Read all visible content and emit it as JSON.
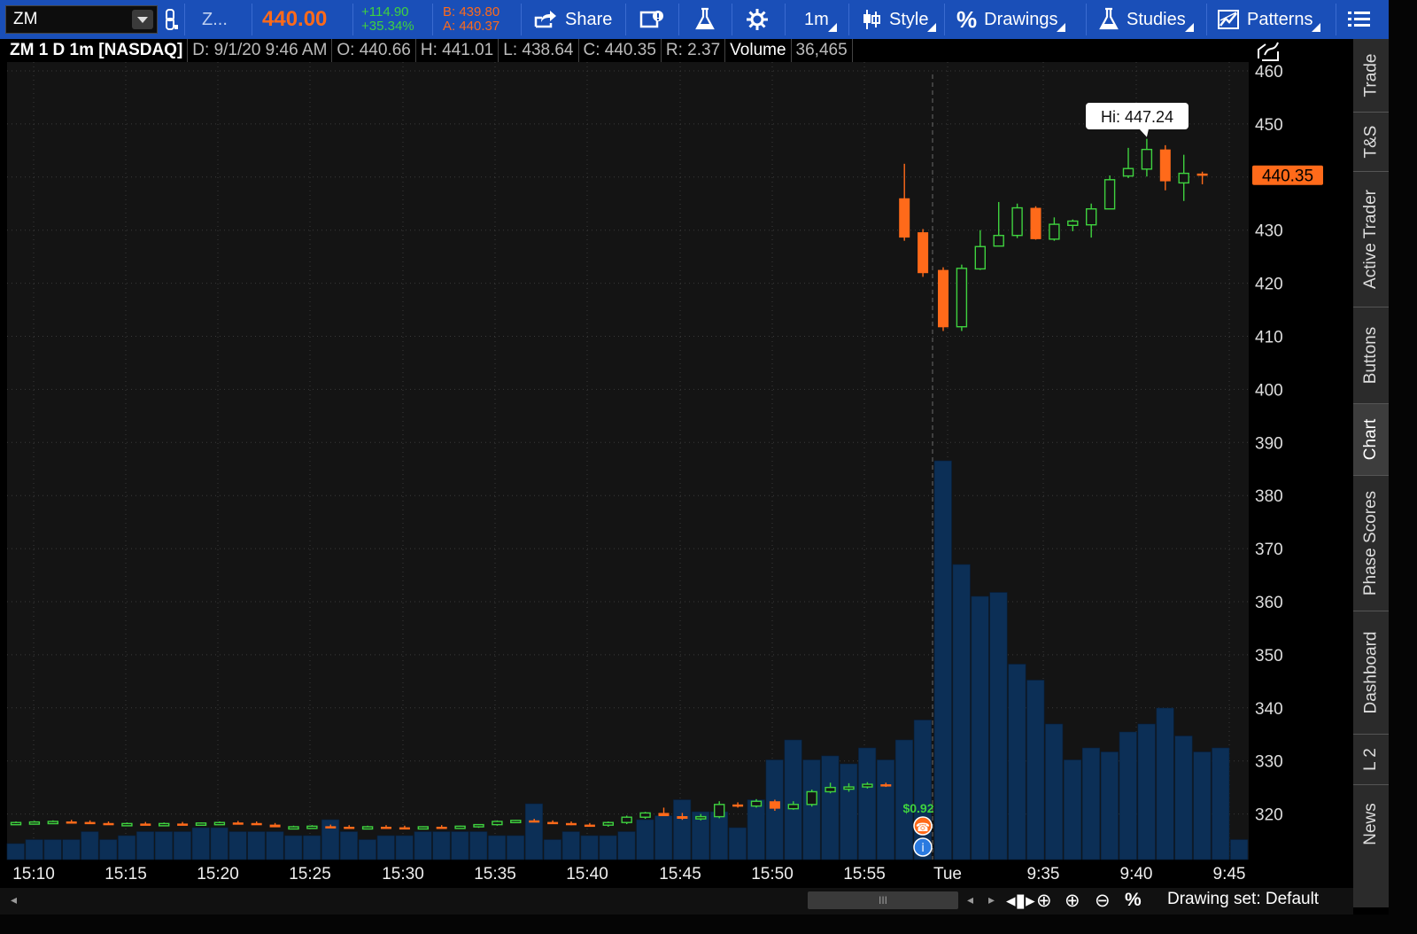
{
  "toolbar": {
    "symbol": "ZM",
    "link_icon": "chain-link-icon",
    "company_short": "Z...",
    "last_price": "440.00",
    "net_change": "+114.90",
    "pct_change": "+35.34%",
    "bid": "B: 439.80",
    "ask": "A: 440.37",
    "share_label": "Share",
    "aggregation": "1m",
    "style_label": "Style",
    "drawings_label": "Drawings",
    "studies_label": "Studies",
    "patterns_label": "Patterns",
    "colors": {
      "accent": "#1a4fb8",
      "price": "#ff6a1a",
      "up": "#3fd23f",
      "down": "#ff6a1a"
    }
  },
  "header": {
    "title": "ZM 1 D 1m [NASDAQ]",
    "date": "D: 9/1/20 9:46 AM",
    "open": "O: 440.66",
    "high": "H: 441.01",
    "low": "L: 438.64",
    "close": "C: 440.35",
    "range": "R: 2.37",
    "volume_label": "Volume",
    "volume_value": "36,465"
  },
  "side_tabs": [
    "Trade",
    "T&S",
    "Active Trader",
    "Buttons",
    "Chart",
    "Phase Scores",
    "Dashboard",
    "L 2",
    "News"
  ],
  "active_tab": "Chart",
  "bottom": {
    "drawing_set": "Drawing set: Default",
    "scroll_grip": "III"
  },
  "chart_data": {
    "type": "candlestick",
    "price_axis": {
      "ticks": [
        460,
        450,
        440,
        430,
        420,
        410,
        400,
        390,
        380,
        370,
        360,
        350,
        340,
        330,
        320
      ],
      "range": [
        311,
        462
      ]
    },
    "time_axis_labels": [
      "15:10",
      "15:15",
      "15:20",
      "15:25",
      "15:30",
      "15:35",
      "15:40",
      "15:45",
      "15:50",
      "15:55",
      "Tue",
      "9:35",
      "9:40",
      "9:45"
    ],
    "last_price_marker": "440.35",
    "hi_label": "Hi: 447.24",
    "event_label": "$0.92",
    "candles": [
      {
        "o": 318.3,
        "h": 318.6,
        "l": 318.0,
        "c": 318.4
      },
      {
        "o": 318.4,
        "h": 318.7,
        "l": 318.1,
        "c": 318.5
      },
      {
        "o": 318.5,
        "h": 318.8,
        "l": 318.2,
        "c": 318.6
      },
      {
        "o": 318.6,
        "h": 318.9,
        "l": 318.3,
        "c": 318.5
      },
      {
        "o": 318.5,
        "h": 318.8,
        "l": 318.2,
        "c": 318.3
      },
      {
        "o": 318.3,
        "h": 318.6,
        "l": 318.0,
        "c": 318.1
      },
      {
        "o": 318.1,
        "h": 318.4,
        "l": 317.8,
        "c": 318.2
      },
      {
        "o": 318.2,
        "h": 318.5,
        "l": 317.9,
        "c": 318.0
      },
      {
        "o": 318.0,
        "h": 318.4,
        "l": 317.8,
        "c": 318.2
      },
      {
        "o": 318.2,
        "h": 318.5,
        "l": 317.9,
        "c": 318.1
      },
      {
        "o": 318.1,
        "h": 318.4,
        "l": 317.8,
        "c": 318.3
      },
      {
        "o": 318.3,
        "h": 318.6,
        "l": 318.0,
        "c": 318.4
      },
      {
        "o": 318.4,
        "h": 318.7,
        "l": 318.1,
        "c": 318.3
      },
      {
        "o": 318.3,
        "h": 318.6,
        "l": 318.0,
        "c": 318.0
      },
      {
        "o": 318.0,
        "h": 318.3,
        "l": 317.6,
        "c": 317.5
      },
      {
        "o": 317.5,
        "h": 317.8,
        "l": 317.2,
        "c": 317.6
      },
      {
        "o": 317.6,
        "h": 317.9,
        "l": 317.3,
        "c": 317.7
      },
      {
        "o": 317.7,
        "h": 318.0,
        "l": 317.4,
        "c": 317.6
      },
      {
        "o": 317.6,
        "h": 317.9,
        "l": 317.3,
        "c": 317.5
      },
      {
        "o": 317.5,
        "h": 317.8,
        "l": 317.2,
        "c": 317.6
      },
      {
        "o": 317.6,
        "h": 317.9,
        "l": 317.3,
        "c": 317.5
      },
      {
        "o": 317.5,
        "h": 317.8,
        "l": 317.2,
        "c": 317.4
      },
      {
        "o": 317.4,
        "h": 317.7,
        "l": 317.1,
        "c": 317.6
      },
      {
        "o": 317.6,
        "h": 317.9,
        "l": 317.3,
        "c": 317.5
      },
      {
        "o": 317.5,
        "h": 317.8,
        "l": 317.2,
        "c": 317.7
      },
      {
        "o": 317.7,
        "h": 318.0,
        "l": 317.4,
        "c": 318.0
      },
      {
        "o": 318.0,
        "h": 318.8,
        "l": 317.8,
        "c": 318.6
      },
      {
        "o": 318.6,
        "h": 318.9,
        "l": 318.3,
        "c": 318.8
      },
      {
        "o": 318.8,
        "h": 319.1,
        "l": 318.5,
        "c": 318.5
      },
      {
        "o": 318.5,
        "h": 318.8,
        "l": 318.2,
        "c": 318.3
      },
      {
        "o": 318.3,
        "h": 318.6,
        "l": 317.9,
        "c": 318.0
      },
      {
        "o": 318.0,
        "h": 318.3,
        "l": 317.7,
        "c": 317.9
      },
      {
        "o": 317.9,
        "h": 318.6,
        "l": 317.6,
        "c": 318.4
      },
      {
        "o": 318.4,
        "h": 319.7,
        "l": 318.1,
        "c": 319.4
      },
      {
        "o": 319.4,
        "h": 320.4,
        "l": 319.1,
        "c": 320.2
      },
      {
        "o": 320.2,
        "h": 321.2,
        "l": 319.9,
        "c": 319.6
      },
      {
        "o": 319.6,
        "h": 320.2,
        "l": 318.9,
        "c": 319.1
      },
      {
        "o": 319.1,
        "h": 320.0,
        "l": 318.8,
        "c": 319.5
      },
      {
        "o": 319.5,
        "h": 322.4,
        "l": 319.2,
        "c": 321.8
      },
      {
        "o": 321.8,
        "h": 322.2,
        "l": 321.2,
        "c": 321.5
      },
      {
        "o": 321.5,
        "h": 322.8,
        "l": 321.2,
        "c": 322.4
      },
      {
        "o": 322.4,
        "h": 322.7,
        "l": 320.6,
        "c": 321.0
      },
      {
        "o": 321.0,
        "h": 322.4,
        "l": 320.8,
        "c": 321.8
      },
      {
        "o": 321.8,
        "h": 324.6,
        "l": 321.4,
        "c": 324.2
      },
      {
        "o": 324.2,
        "h": 325.9,
        "l": 323.9,
        "c": 325.0
      },
      {
        "o": 325.0,
        "h": 325.8,
        "l": 324.2,
        "c": 325.1
      },
      {
        "o": 325.1,
        "h": 326.0,
        "l": 324.8,
        "c": 325.6
      },
      {
        "o": 325.6,
        "h": 325.9,
        "l": 325.1,
        "c": 325.2
      },
      {
        "o": 436.0,
        "h": 442.5,
        "l": 428.0,
        "c": 428.6
      },
      {
        "o": 429.6,
        "h": 430.2,
        "l": 421.2,
        "c": 421.9
      },
      {
        "o": 422.5,
        "h": 423.0,
        "l": 411.0,
        "c": 411.7
      },
      {
        "o": 411.8,
        "h": 423.5,
        "l": 411.0,
        "c": 422.8
      },
      {
        "o": 422.7,
        "h": 430.0,
        "l": 422.5,
        "c": 426.9
      },
      {
        "o": 427.0,
        "h": 435.3,
        "l": 427.0,
        "c": 429.0
      },
      {
        "o": 429.0,
        "h": 435.0,
        "l": 428.5,
        "c": 434.2
      },
      {
        "o": 434.2,
        "h": 434.5,
        "l": 428.2,
        "c": 428.3
      },
      {
        "o": 428.3,
        "h": 432.4,
        "l": 428.0,
        "c": 431.1
      },
      {
        "o": 430.9,
        "h": 432.0,
        "l": 429.8,
        "c": 431.7
      },
      {
        "o": 431.0,
        "h": 435.0,
        "l": 428.6,
        "c": 434.0
      },
      {
        "o": 434.0,
        "h": 440.3,
        "l": 434.0,
        "c": 439.5
      },
      {
        "o": 440.2,
        "h": 445.5,
        "l": 439.8,
        "c": 441.6
      },
      {
        "o": 441.5,
        "h": 447.2,
        "l": 440.1,
        "c": 445.2
      },
      {
        "o": 445.2,
        "h": 446.0,
        "l": 437.5,
        "c": 439.2
      },
      {
        "o": 438.9,
        "h": 444.2,
        "l": 435.5,
        "c": 440.7
      },
      {
        "o": 440.66,
        "h": 441.01,
        "l": 438.64,
        "c": 440.35
      }
    ],
    "volume": [
      4,
      5,
      5,
      5,
      7,
      5,
      6,
      7,
      7,
      7,
      8,
      8,
      7,
      7,
      7,
      6,
      6,
      10,
      7,
      5,
      6,
      6,
      7,
      7,
      7,
      7,
      6,
      6,
      14,
      5,
      7,
      6,
      6,
      7,
      10,
      11,
      15,
      12,
      12,
      8,
      15,
      25,
      30,
      25,
      26,
      24,
      28,
      25,
      30,
      35,
      100,
      74,
      66,
      67,
      49,
      45,
      34,
      25,
      28,
      27,
      32,
      34,
      38,
      31,
      27,
      28,
      5
    ]
  }
}
